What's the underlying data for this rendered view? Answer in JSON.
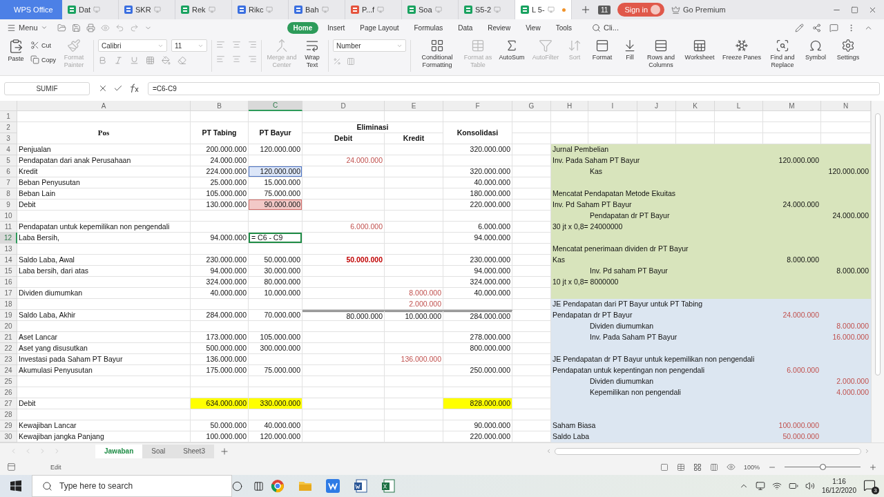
{
  "window": {
    "app": "WPS Office",
    "tabs": [
      {
        "label": "Dat",
        "kind": "sheet",
        "selected": false
      },
      {
        "label": "SKR",
        "kind": "writer",
        "selected": false
      },
      {
        "label": "Rek",
        "kind": "sheet",
        "selected": false
      },
      {
        "label": "Rikc",
        "kind": "writer",
        "selected": false
      },
      {
        "label": "Bah",
        "kind": "writer",
        "selected": false
      },
      {
        "label": "P...f",
        "kind": "pdf",
        "selected": false
      },
      {
        "label": "Soa",
        "kind": "sheet",
        "selected": false
      },
      {
        "label": "S5-2",
        "kind": "sheet",
        "selected": false
      },
      {
        "label": "L 5-",
        "kind": "sheet",
        "selected": true
      }
    ],
    "tab_count": "11",
    "sign_in": "Sign in",
    "premium": "Go Premium"
  },
  "ribbon": {
    "menu": "Menu",
    "tabs": [
      {
        "label": "Home",
        "selected": true
      },
      {
        "label": "Insert",
        "selected": false
      },
      {
        "label": "Page Layout",
        "selected": false
      },
      {
        "label": "Formulas",
        "selected": false
      },
      {
        "label": "Data",
        "selected": false
      },
      {
        "label": "Review",
        "selected": false
      },
      {
        "label": "View",
        "selected": false
      },
      {
        "label": "Tools",
        "selected": false
      }
    ],
    "search": "Cli...",
    "clipboard": [
      {
        "label": "Paste",
        "disabled": false
      },
      {
        "label": "Cut",
        "disabled": false
      },
      {
        "label": "Copy",
        "disabled": false
      },
      {
        "label": "Format Painter",
        "disabled": true
      }
    ],
    "font": {
      "name": "Calibri",
      "size": "11"
    },
    "align_tools": [
      {
        "label": "Merge and Center",
        "disabled": true
      },
      {
        "label": "Wrap Text",
        "disabled": false
      }
    ],
    "number_format": "Number",
    "tools": [
      {
        "label": "Conditional Formatting",
        "disabled": false
      },
      {
        "label": "Format as Table",
        "disabled": true
      },
      {
        "label": "AutoSum",
        "disabled": false
      },
      {
        "label": "AutoFilter",
        "disabled": true
      },
      {
        "label": "Sort",
        "disabled": true
      },
      {
        "label": "Format",
        "disabled": false
      },
      {
        "label": "Fill",
        "disabled": false
      },
      {
        "label": "Rows and Columns",
        "disabled": false
      },
      {
        "label": "Worksheet",
        "disabled": false
      },
      {
        "label": "Freeze Panes",
        "disabled": false
      },
      {
        "label": "Find and Replace",
        "disabled": false
      },
      {
        "label": "Symbol",
        "disabled": false
      },
      {
        "label": "Settings",
        "disabled": false
      }
    ]
  },
  "formula_bar": {
    "name_box": "SUMIF",
    "formula": "=C6-C9"
  },
  "sheet": {
    "columns": [
      {
        "label": "A",
        "selected": false
      },
      {
        "label": "B",
        "selected": false
      },
      {
        "label": "C",
        "selected": true
      },
      {
        "label": "D",
        "selected": false
      },
      {
        "label": "E",
        "selected": false
      },
      {
        "label": "F",
        "selected": false
      },
      {
        "label": "G",
        "selected": false
      },
      {
        "label": "H",
        "selected": false
      },
      {
        "label": "I",
        "selected": false
      },
      {
        "label": "J",
        "selected": false
      },
      {
        "label": "K",
        "selected": false
      },
      {
        "label": "L",
        "selected": false
      },
      {
        "label": "M",
        "selected": false
      },
      {
        "label": "N",
        "selected": false
      }
    ],
    "rows": [
      {
        "n": "1",
        "kind": "plain",
        "selected": false
      },
      {
        "n": "2",
        "kind": "header-top",
        "selected": false,
        "a": "Pos",
        "b": "PT Tabing",
        "c": "PT Bayur",
        "d": "Eliminasi",
        "f": "Konsolidasi"
      },
      {
        "n": "3",
        "kind": "header-bottom",
        "selected": false,
        "d": "Debit",
        "e": "Kredit"
      },
      {
        "n": "4",
        "kind": "plain",
        "selected": false,
        "a": "Penjualan",
        "b": "200.000.000",
        "c": "120.000.000",
        "f": "320.000.000",
        "journal": {
          "color": "#d8e4bc",
          "text": "Jurnal Pembelian",
          "indent": false
        }
      },
      {
        "n": "5",
        "kind": "plain",
        "selected": false,
        "a": "Pendapatan dari anak Perusahaan",
        "b": "24.000.000",
        "d": {
          "text": "24.000.000",
          "kind": "red"
        },
        "journal": {
          "color": "#d8e4bc",
          "text": "Inv. Pada Saham PT Bayur",
          "indent": false,
          "m": "120.000.000"
        }
      },
      {
        "n": "6",
        "kind": "plain",
        "selected": false,
        "a": "Kredit",
        "b": "224.000.000",
        "c": {
          "text": "120.000.000",
          "kind": "ref-blue"
        },
        "f": "320.000.000",
        "journal": {
          "color": "#d8e4bc",
          "text": "Kas",
          "indent": true,
          "n": "120.000.000"
        }
      },
      {
        "n": "7",
        "kind": "plain",
        "selected": false,
        "a": "Beban Penyusutan",
        "b": "25.000.000",
        "c": "15.000.000",
        "f": "40.000.000",
        "journal": {
          "color": "#d8e4bc"
        }
      },
      {
        "n": "8",
        "kind": "plain",
        "selected": false,
        "a": "Beban Lain",
        "b": "105.000.000",
        "c": "75.000.000",
        "f": "180.000.000",
        "journal": {
          "color": "#d8e4bc",
          "text": "Mencatat Pendapatan Metode Ekuitas",
          "indent": false
        }
      },
      {
        "n": "9",
        "kind": "plain",
        "selected": false,
        "a": "Debit",
        "b": "130.000.000",
        "c": {
          "text": "90.000.000",
          "kind": "ref-red"
        },
        "f": "220.000.000",
        "journal": {
          "color": "#d8e4bc",
          "text": "Inv. Pd Saham PT Bayur",
          "indent": false,
          "m": "24.000.000"
        }
      },
      {
        "n": "10",
        "kind": "plain",
        "selected": false,
        "journal": {
          "color": "#d8e4bc",
          "text": "Pendapatan dr PT Bayur",
          "indent": true,
          "n": "24.000.000"
        }
      },
      {
        "n": "11",
        "kind": "plain",
        "selected": false,
        "a": "Pendapatan untuk kepemilikan non pengendali",
        "d": {
          "text": "6.000.000",
          "kind": "red"
        },
        "f": "6.000.000",
        "journal": {
          "color": "#d8e4bc",
          "text": "30 jt x 0,8= 24000000",
          "indent": false
        }
      },
      {
        "n": "12",
        "kind": "plain",
        "selected": true,
        "a": "Laba Bersih,",
        "b": "94.000.000",
        "c": {
          "text": "= C6 - C9",
          "kind": "editing"
        },
        "f": "94.000.000",
        "journal": {
          "color": "#d8e4bc"
        }
      },
      {
        "n": "13",
        "kind": "plain",
        "selected": false,
        "journal": {
          "color": "#d8e4bc",
          "text": "Mencatat penerimaan dividen dr PT Bayur",
          "indent": false
        }
      },
      {
        "n": "14",
        "kind": "plain",
        "selected": false,
        "a": "Saldo Laba, Awal",
        "b": "230.000.000",
        "c": "50.000.000",
        "d": {
          "text": "50.000.000",
          "kind": "red-bold"
        },
        "f": "230.000.000",
        "journal": {
          "color": "#d8e4bc",
          "text": "Kas",
          "indent": false,
          "m": "8.000.000"
        }
      },
      {
        "n": "15",
        "kind": "plain",
        "selected": false,
        "a": "Laba bersih, dari atas",
        "b": "94.000.000",
        "c": "30.000.000",
        "f": "94.000.000",
        "journal": {
          "color": "#d8e4bc",
          "text": "Inv. Pd saham PT Bayur",
          "indent": true,
          "n": "8.000.000"
        }
      },
      {
        "n": "16",
        "kind": "plain",
        "selected": false,
        "b": "324.000.000",
        "c": "80.000.000",
        "f": "324.000.000",
        "journal": {
          "color": "#d8e4bc",
          "text": "10 jt x 0,8= 8000000",
          "indent": false
        }
      },
      {
        "n": "17",
        "kind": "plain",
        "selected": false,
        "a": "Dividen diumumkan",
        "b": "40.000.000",
        "c": "10.000.000",
        "e": {
          "text": "8.000.000",
          "kind": "red"
        },
        "f": "40.000.000",
        "journal": {
          "color": "#d8e4bc"
        }
      },
      {
        "n": "18",
        "kind": "plain",
        "selected": false,
        "e": {
          "text": "2.000.000",
          "kind": "red"
        },
        "journal": {
          "color": "#dce6f1",
          "text": "JE Pendapatan dari PT Bayur untuk PT Tabing",
          "indent": false
        }
      },
      {
        "n": "19",
        "kind": "plain",
        "selected": false,
        "double_rule_above": true,
        "a": "Saldo Laba, Akhir",
        "b": "284.000.000",
        "c": "70.000.000",
        "d": "80.000.000",
        "e": "10.000.000",
        "f": "284.000.000",
        "journal": {
          "color": "#dce6f1",
          "text": "Pendapatan dr PT Bayur",
          "indent": false,
          "m": {
            "text": "24.000.000",
            "kind": "red"
          }
        }
      },
      {
        "n": "20",
        "kind": "plain",
        "selected": false,
        "journal": {
          "color": "#dce6f1",
          "text": "Dividen diumumkan",
          "indent": true,
          "n": {
            "text": "8.000.000",
            "kind": "red"
          }
        }
      },
      {
        "n": "21",
        "kind": "plain",
        "selected": false,
        "a": "Aset Lancar",
        "b": "173.000.000",
        "c": "105.000.000",
        "f": "278.000.000",
        "journal": {
          "color": "#dce6f1",
          "text": "Inv. Pada Saham PT Bayur",
          "indent": true,
          "n": {
            "text": "16.000.000",
            "kind": "red"
          }
        }
      },
      {
        "n": "22",
        "kind": "plain",
        "selected": false,
        "a": "Aset yang disusutkan",
        "b": "500.000.000",
        "c": "300.000.000",
        "f": "800.000.000",
        "journal": {
          "color": "#dce6f1"
        }
      },
      {
        "n": "23",
        "kind": "plain",
        "selected": false,
        "a": "Investasi pada Saham PT Bayur",
        "b": "136.000.000",
        "e": {
          "text": "136.000.000",
          "kind": "red"
        },
        "journal": {
          "color": "#dce6f1",
          "text": "JE Pendapatan dr PT Bayur untuk kepemilikan non pengendali",
          "indent": false
        }
      },
      {
        "n": "24",
        "kind": "plain",
        "selected": false,
        "a": "Akumulasi Penyusutan",
        "b": "175.000.000",
        "c": "75.000.000",
        "f": "250.000.000",
        "journal": {
          "color": "#dce6f1",
          "text": "Pendapatan untuk kepentingan non pengendali",
          "indent": false,
          "m": {
            "text": "6.000.000",
            "kind": "red"
          }
        }
      },
      {
        "n": "25",
        "kind": "plain",
        "selected": false,
        "journal": {
          "color": "#dce6f1",
          "text": "Dividen diumumkan",
          "indent": true,
          "n": {
            "text": "2.000.000",
            "kind": "red"
          }
        }
      },
      {
        "n": "26",
        "kind": "plain",
        "selected": false,
        "journal": {
          "color": "#dce6f1",
          "text": "Kepemilikan non pengendali",
          "indent": true,
          "n": {
            "text": "4.000.000",
            "kind": "red"
          }
        }
      },
      {
        "n": "27",
        "kind": "plain",
        "selected": false,
        "a": "Debit",
        "b": {
          "text": "634.000.000",
          "kind": "yellow"
        },
        "c": {
          "text": "330.000.000",
          "kind": "yellow"
        },
        "f": {
          "text": "828.000.000",
          "kind": "yellow"
        },
        "journal": {
          "color": "#dce6f1"
        }
      },
      {
        "n": "28",
        "kind": "plain",
        "selected": false,
        "journal": {
          "color": "#dce6f1"
        }
      },
      {
        "n": "29",
        "kind": "plain",
        "selected": false,
        "a": "Kewajiban Lancar",
        "b": "50.000.000",
        "c": "40.000.000",
        "f": "90.000.000",
        "journal": {
          "color": "#dce6f1",
          "text": "Saham Biasa",
          "indent": false,
          "m": {
            "text": "100.000.000",
            "kind": "red"
          }
        }
      },
      {
        "n": "30",
        "kind": "plain",
        "selected": false,
        "a": "Kewajiban jangka Panjang",
        "b": "100.000.000",
        "c": "120.000.000",
        "f": "220.000.000",
        "journal": {
          "color": "#dce6f1",
          "text": "Saldo Laba",
          "indent": false,
          "m": {
            "text": "50.000.000",
            "kind": "red"
          }
        }
      }
    ]
  },
  "sheet_tabs": [
    {
      "label": "Jawaban",
      "selected": true
    },
    {
      "label": "Soal",
      "selected": false
    },
    {
      "label": "Sheet3",
      "selected": false
    }
  ],
  "status_bar": {
    "mode": "Edit",
    "zoom": {
      "reading": "100%",
      "level": 0.5
    }
  },
  "taskbar": {
    "search": "Type here to search",
    "time": "1:16",
    "date": "16/12/2020",
    "notifications": "3"
  }
}
